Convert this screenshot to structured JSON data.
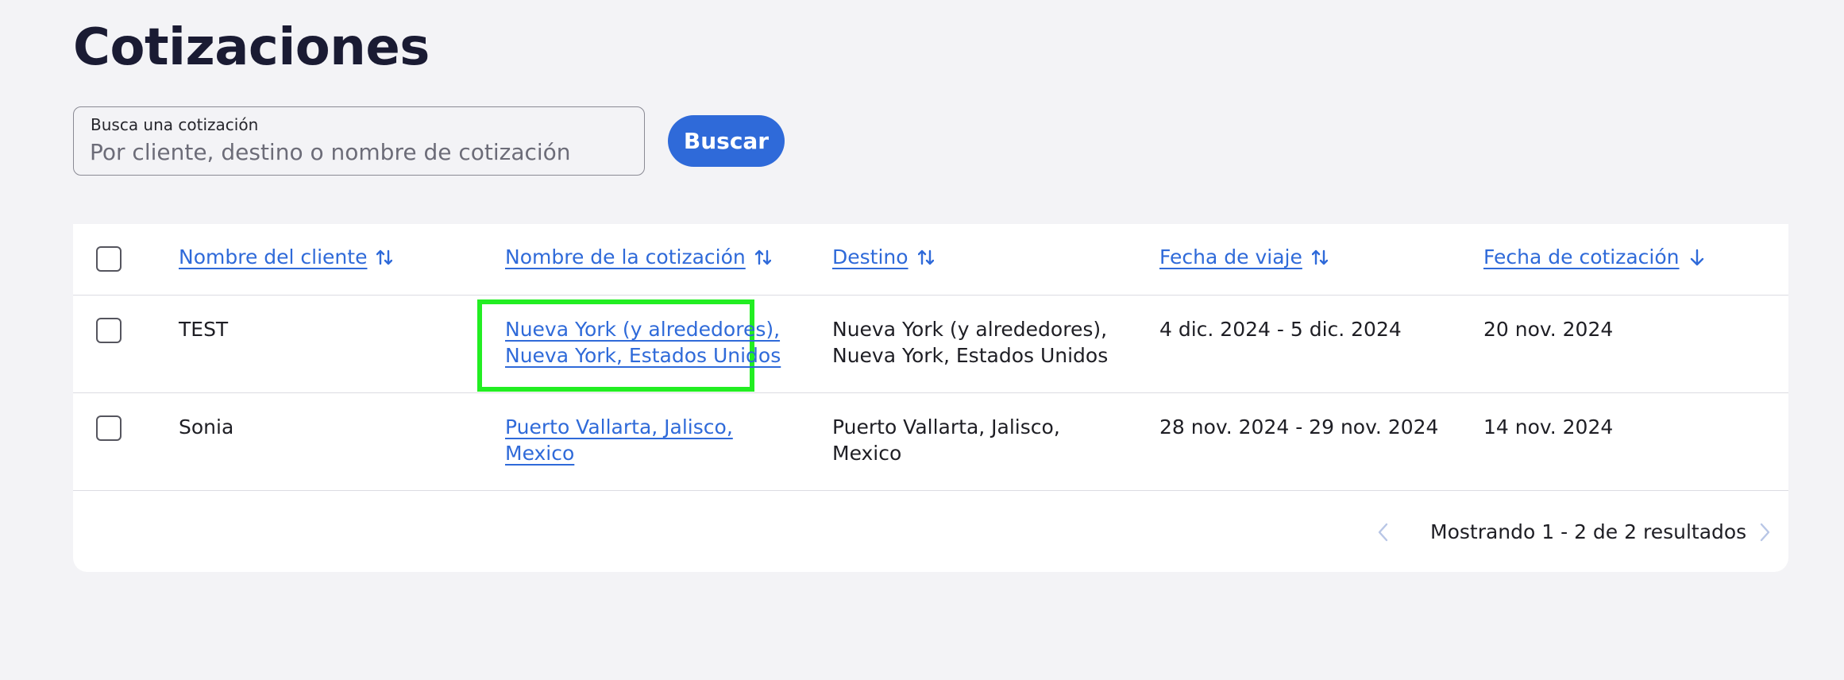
{
  "page": {
    "title": "Cotizaciones"
  },
  "search": {
    "label": "Busca una cotización",
    "placeholder": "Por cliente, destino o nombre de cotización",
    "value": "",
    "button_label": "Buscar"
  },
  "table": {
    "columns": [
      {
        "label": "Nombre del cliente",
        "sort_icon": "sort-both-icon"
      },
      {
        "label": "Nombre de la cotización",
        "sort_icon": "sort-both-icon"
      },
      {
        "label": "Destino",
        "sort_icon": "sort-both-icon"
      },
      {
        "label": "Fecha de viaje",
        "sort_icon": "sort-both-icon"
      },
      {
        "label": "Fecha de cotización",
        "sort_icon": "sort-desc-icon"
      }
    ],
    "rows": [
      {
        "client": "TEST",
        "quote_name": [
          "Nueva York (y alrededores),",
          "Nueva York, Estados Unidos"
        ],
        "destination": [
          "Nueva York (y alrededores),",
          "Nueva York, Estados Unidos"
        ],
        "travel_dates": "4 dic. 2024 - 5 dic. 2024",
        "quote_date": "20 nov. 2024",
        "highlighted": true
      },
      {
        "client": "Sonia",
        "quote_name": [
          "Puerto Vallarta, Jalisco,",
          "Mexico"
        ],
        "destination": [
          "Puerto Vallarta, Jalisco,",
          "Mexico"
        ],
        "travel_dates": "28 nov. 2024 - 29 nov. 2024",
        "quote_date": "14 nov. 2024",
        "highlighted": false
      }
    ]
  },
  "pagination": {
    "text": "Mostrando 1 - 2 de 2 resultados"
  },
  "colors": {
    "accent": "#2f6ad9",
    "highlight": "#22ee22",
    "background": "#f3f3f6"
  }
}
